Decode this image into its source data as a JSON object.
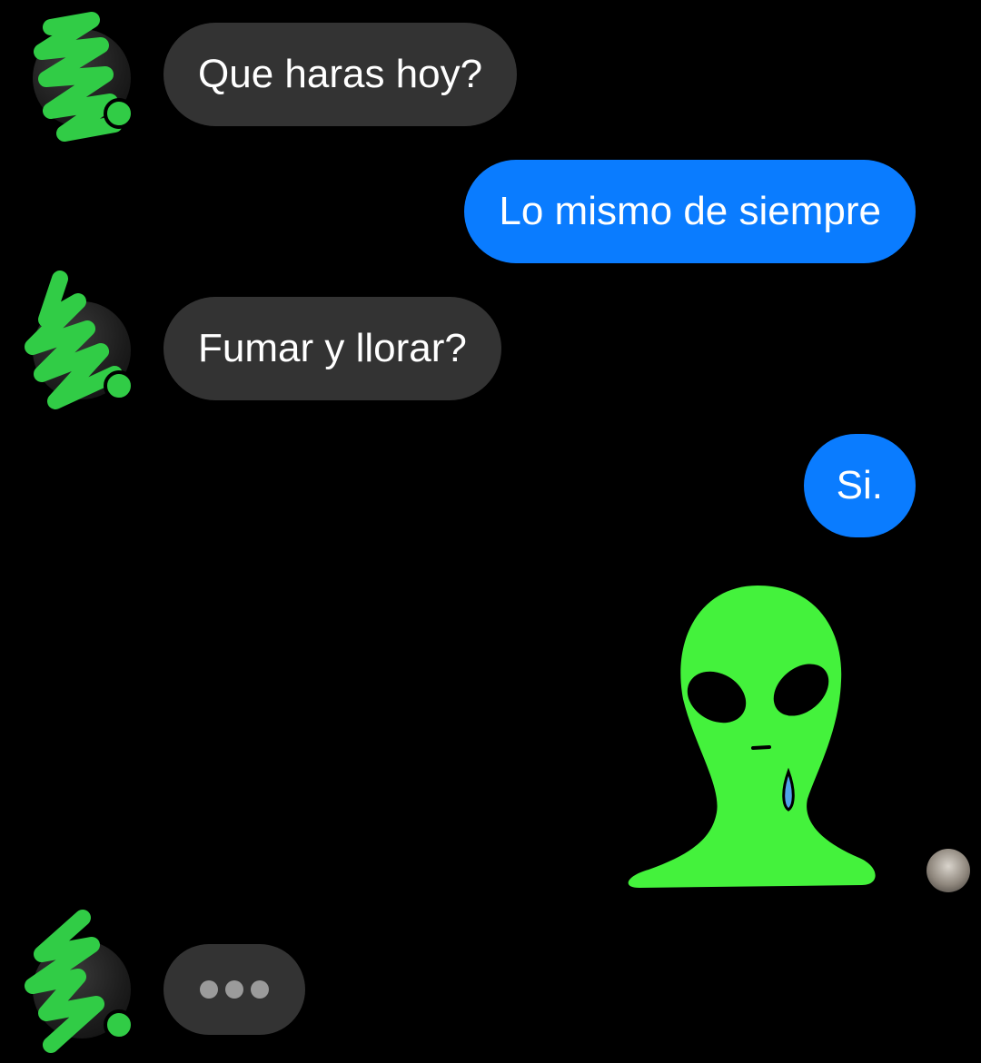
{
  "messages": [
    {
      "sender": "contact",
      "text": "Que haras hoy?"
    },
    {
      "sender": "me",
      "text": "Lo mismo de siempre"
    },
    {
      "sender": "contact",
      "text": "Fumar y llorar?"
    },
    {
      "sender": "me",
      "text": "Si."
    },
    {
      "sender": "me",
      "type": "sticker",
      "sticker": "crying-alien-icon"
    }
  ],
  "typing_indicator": {
    "visible": true
  },
  "colors": {
    "background": "#000000",
    "incoming_bubble": "#333333",
    "outgoing_bubble": "#0a7cff",
    "online": "#31cc46",
    "scribble": "#31cc46",
    "alien": "#44f23c"
  }
}
